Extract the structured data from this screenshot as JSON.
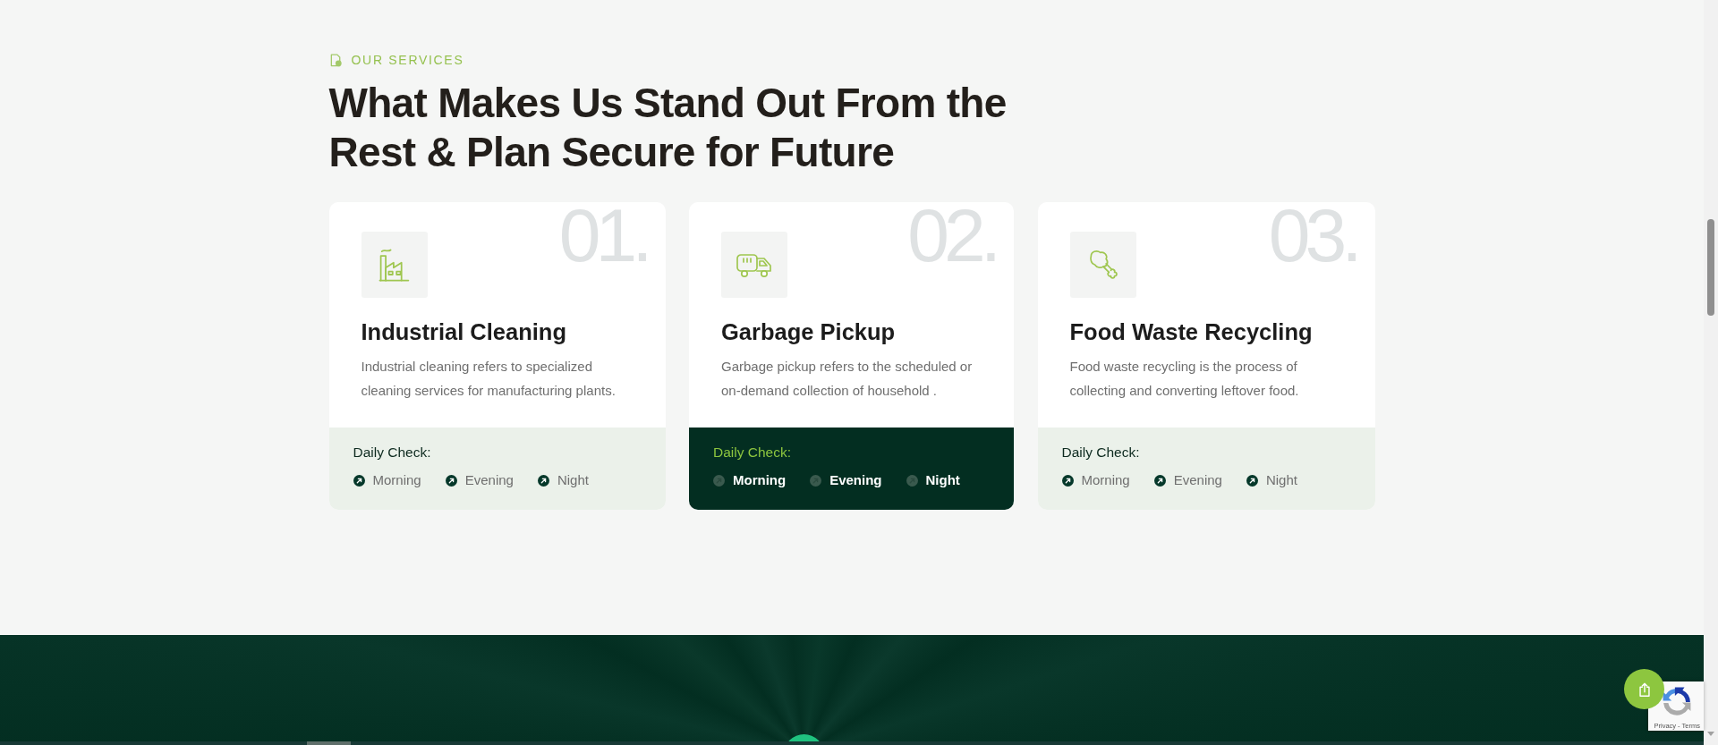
{
  "section": {
    "eyebrow": "OUR SERVICES",
    "heading": "What Makes Us Stand Out From the Rest & Plan Secure for Future"
  },
  "cards": [
    {
      "number": "01.",
      "title": "Industrial Cleaning",
      "description": "Industrial cleaning refers to specialized cleaning services for manufacturing plants.",
      "check_label": "Daily Check:",
      "times": [
        "Morning",
        "Evening",
        "Night"
      ],
      "selected": false
    },
    {
      "number": "02.",
      "title": "Garbage Pickup",
      "description": "Garbage pickup refers to the scheduled or on-demand collection of household .",
      "check_label": "Daily Check:",
      "times": [
        "Morning",
        "Evening",
        "Night"
      ],
      "selected": true
    },
    {
      "number": "03.",
      "title": "Food Waste Recycling",
      "description": "Food waste recycling is the process of collecting and converting leftover food.",
      "check_label": "Daily Check:",
      "times": [
        "Morning",
        "Evening",
        "Night"
      ],
      "selected": false
    }
  ],
  "recaptcha": {
    "links": [
      "Privacy",
      "Terms"
    ],
    "separator": "-"
  }
}
